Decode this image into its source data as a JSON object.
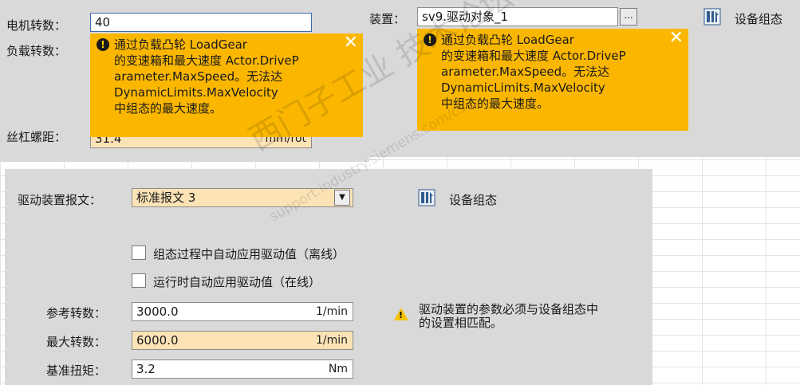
{
  "left_panel": {
    "motor_speed_label": "电机转数：",
    "motor_speed_value": "40",
    "load_speed_label": "负载转数：",
    "screw_pitch_label": "丝杠螺距：",
    "screw_pitch_value": "31.4",
    "screw_pitch_unit": "mm/rot"
  },
  "tooltip": {
    "lines": [
      "通过负载凸轮 LoadGear",
      "的变速箱和最大速度 Actor.DriveP",
      "arameter.MaxSpeed。无法达",
      "DynamicLimits.MaxVelocity",
      "中组态的最大速度。"
    ],
    "close": "✕"
  },
  "right_panel": {
    "device_label": "装置：",
    "device_value": "sv9.驱动对象_1",
    "browse": "...",
    "device_config": "设备组态"
  },
  "bottom_panel": {
    "telegram_label": "驱动装置报文：",
    "telegram_value": "标准报文 3",
    "device_config": "设备组态",
    "checkbox_offline": "组态过程中自动应用驱动值（离线）",
    "checkbox_online": "运行时自动应用驱动值（在线）",
    "ref_speed_label": "参考转数：",
    "ref_speed_value": "3000.0",
    "ref_speed_unit": "1/min",
    "max_speed_label": "最大转数：",
    "max_speed_value": "6000.0",
    "max_speed_unit": "1/min",
    "torque_label": "基准扭矩：",
    "torque_value": "3.2",
    "torque_unit": "Nm",
    "warning_text_1": "驱动装置的参数必须与设备组态中",
    "warning_text_2": "的设置相匹配。"
  },
  "watermark": {
    "main": "西门子工业  技术论坛",
    "sub": "support.industry.siemens.com/cs"
  },
  "colors": {
    "tooltip": "#fbb700",
    "panel": "#d9d9d9",
    "highlight_field": "#fbe3b6"
  }
}
